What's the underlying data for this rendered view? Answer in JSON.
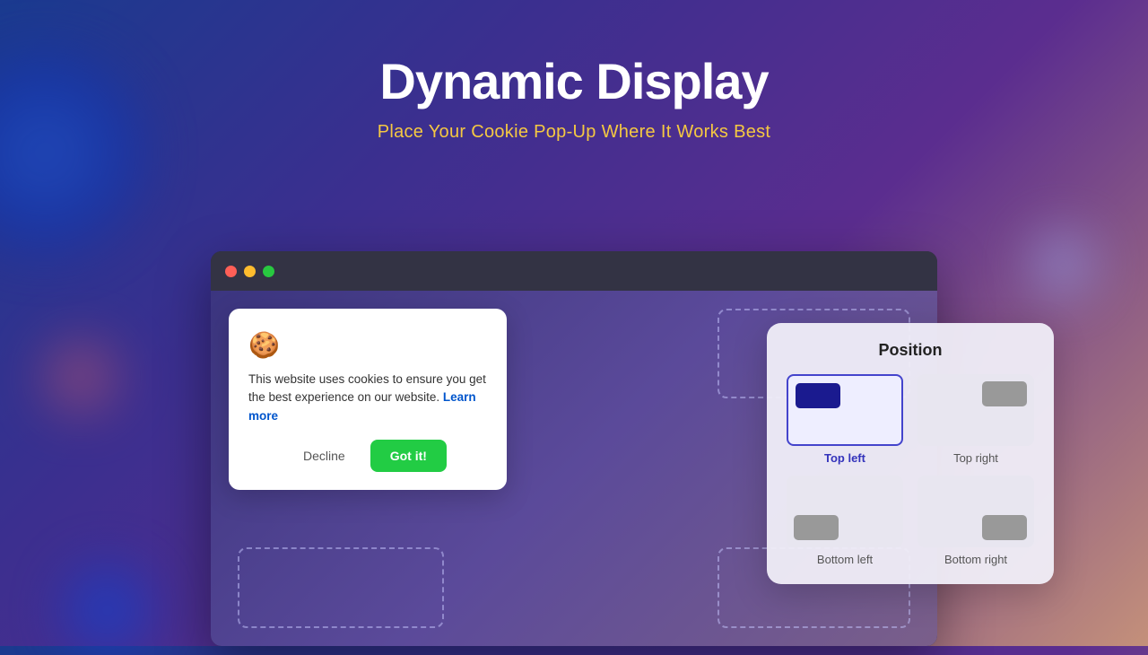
{
  "page": {
    "title": "Dynamic Display",
    "subtitle": "Place Your Cookie Pop-Up Where It Works Best"
  },
  "browser": {
    "dots": [
      "red",
      "yellow",
      "green"
    ]
  },
  "cookie_popup": {
    "icon": "🍪",
    "text": "This website uses cookies to ensure you get the best experience on our website.",
    "link_text": "Learn more",
    "btn_decline": "Decline",
    "btn_accept": "Got it!"
  },
  "position_panel": {
    "title": "Position",
    "options": [
      {
        "id": "top-left",
        "label": "Top left",
        "selected": true
      },
      {
        "id": "top-right",
        "label": "Top right",
        "selected": false
      },
      {
        "id": "bottom-left",
        "label": "Bottom left",
        "selected": false
      },
      {
        "id": "bottom-right",
        "label": "Bottom right",
        "selected": false
      }
    ]
  }
}
